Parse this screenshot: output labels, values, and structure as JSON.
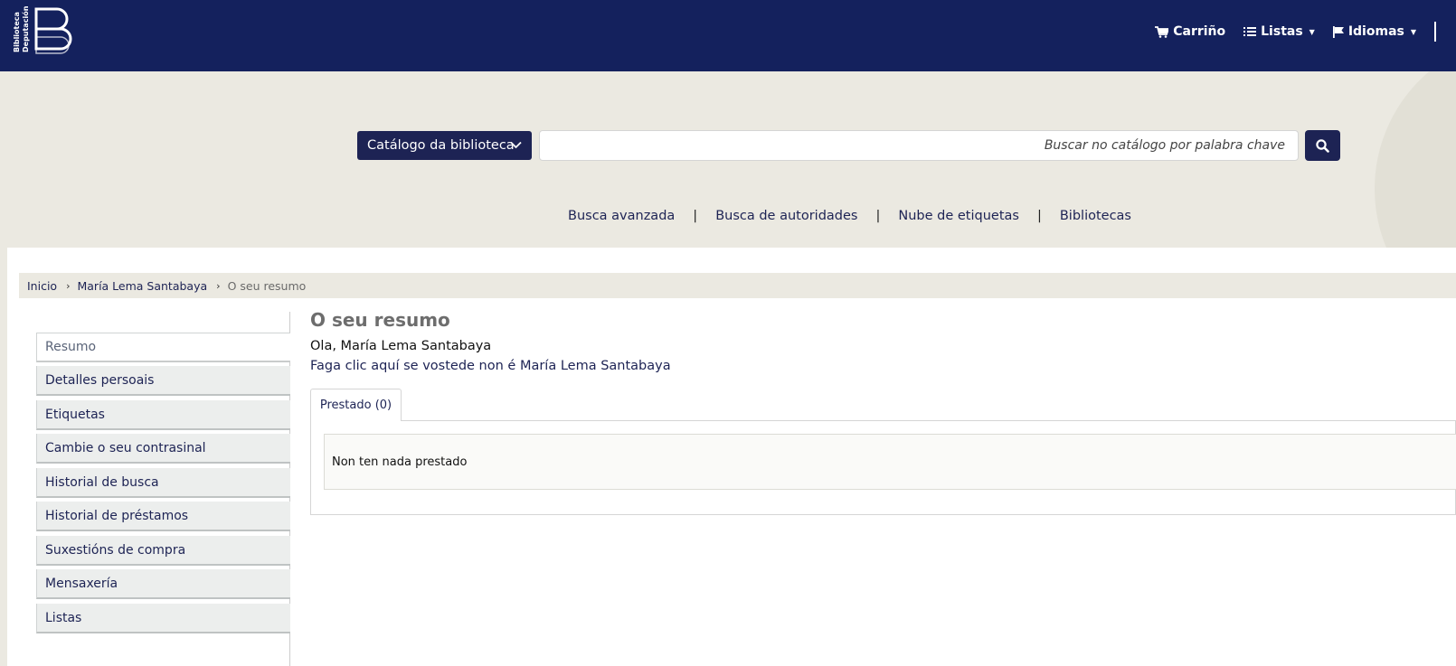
{
  "brand": {
    "logo_line1": "Biblioteca",
    "logo_line2": "Deputación",
    "logo_icon": "bb-logo-icon"
  },
  "top_menu": {
    "cart_label": "Carriño",
    "lists_label": "Listas",
    "languages_label": "Idiomas"
  },
  "search": {
    "catalog_select": "Catálogo da biblioteca",
    "placeholder": "Buscar no catálogo por palabra chave",
    "button_icon": "search-icon"
  },
  "search_links": [
    "Busca avanzada",
    "Busca de autoridades",
    "Nube de etiquetas",
    "Bibliotecas"
  ],
  "link_separator": "|",
  "breadcrumb": {
    "home": "Inicio",
    "user": "María Lema Santabaya",
    "current": "O seu resumo",
    "separator": "›"
  },
  "sidebar": {
    "items": [
      {
        "label": "Resumo",
        "active": true
      },
      {
        "label": "Detalles persoais"
      },
      {
        "label": "Etiquetas"
      },
      {
        "label": "Cambie o seu contrasinal"
      },
      {
        "label": "Historial de busca"
      },
      {
        "label": "Historial de préstamos"
      },
      {
        "label": "Suxestións de compra"
      },
      {
        "label": "Mensaxería"
      },
      {
        "label": "Listas"
      }
    ]
  },
  "main": {
    "title": "O seu resumo",
    "greeting": "Ola, María Lema Santabaya",
    "not_you_link": "Faga clic aquí se vostede non é María Lema Santabaya",
    "tab_label": "Prestado (0)",
    "empty_message": "Non ten nada prestado"
  },
  "colors": {
    "navbar": "#14215d",
    "accent": "#1d2354",
    "background": "#ebe9e1"
  }
}
